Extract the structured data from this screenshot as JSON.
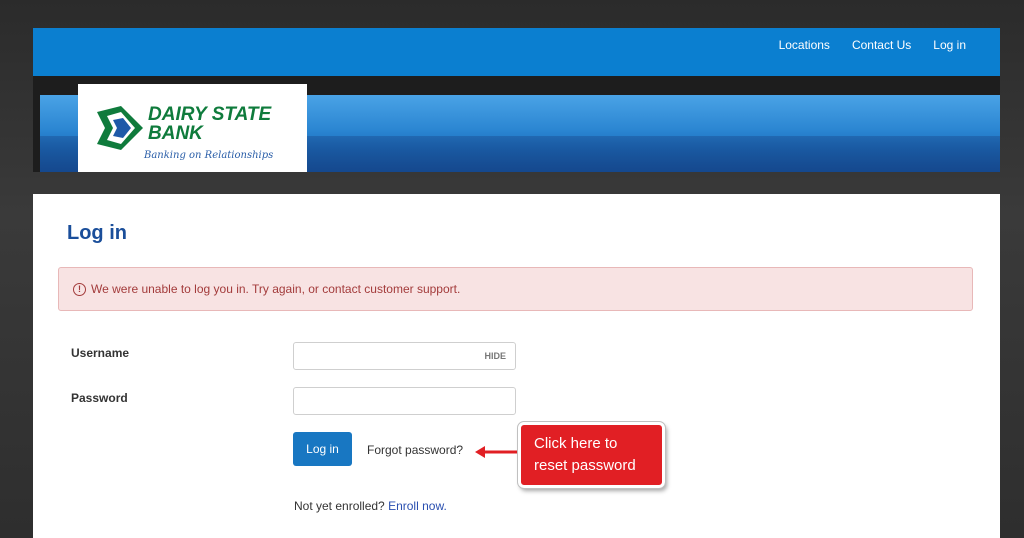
{
  "nav": {
    "locations": "Locations",
    "contact_us": "Contact Us",
    "login": "Log in"
  },
  "logo": {
    "line1": "DAIRY STATE",
    "line2": "BANK",
    "tagline": "Banking on Relationships"
  },
  "page": {
    "title": "Log in",
    "alert_text": "We were unable to log you in. Try again, or contact customer support.",
    "alert_icon": "!",
    "username_label": "Username",
    "password_label": "Password",
    "hide_label": "HIDE",
    "login_button": "Log in",
    "forgot_link": "Forgot password?",
    "enroll_prefix": "Not yet enrolled?",
    "enroll_link": "Enroll now."
  },
  "annotation": {
    "line1": "Click here to",
    "line2": "reset password"
  },
  "colors": {
    "brand_blue": "#0b7fd0",
    "logo_green": "#0f7b3c",
    "callout_red": "#e11f24",
    "alert_text": "#a33b3b"
  }
}
